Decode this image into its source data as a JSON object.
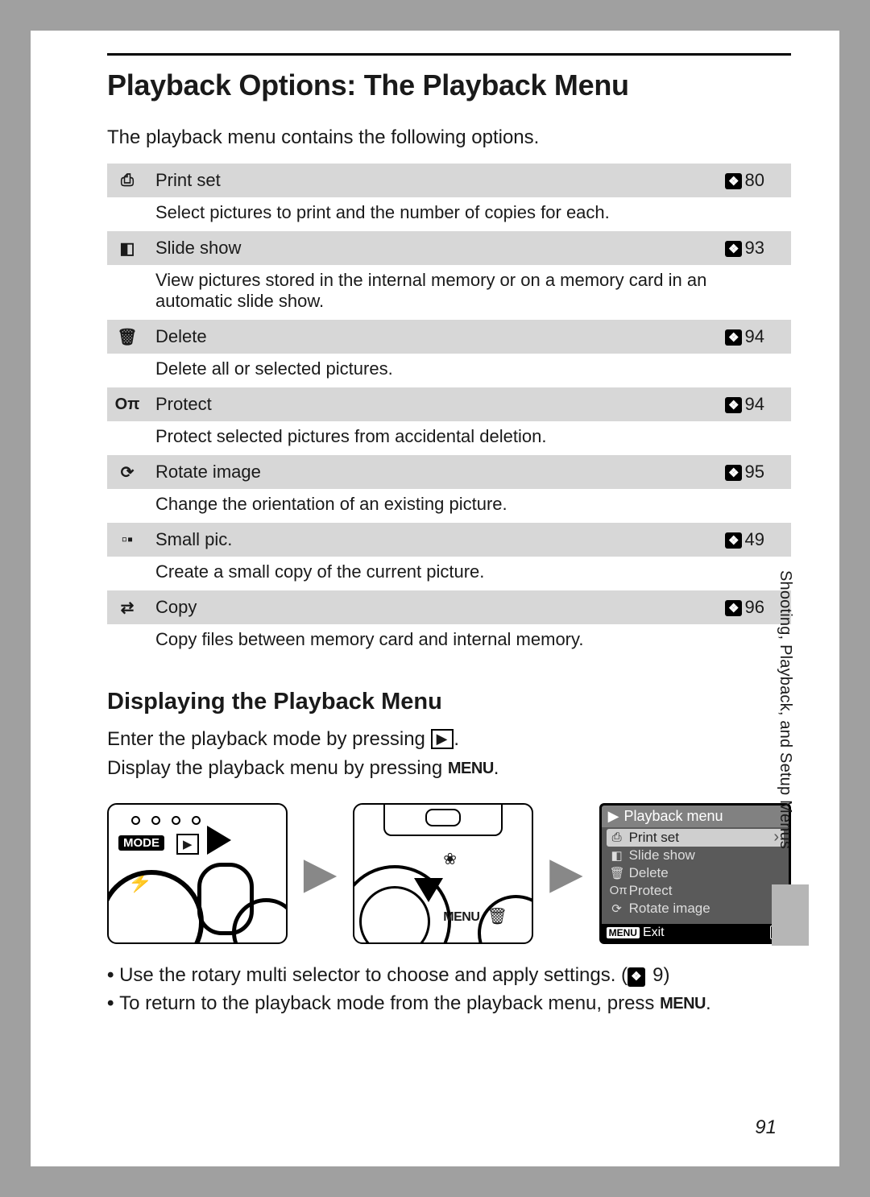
{
  "heading": "Playback Options: The Playback Menu",
  "intro": "The playback menu contains the following options.",
  "ref_badge": "❖",
  "options": [
    {
      "icon": "⎙",
      "title": "Print set",
      "page": "80",
      "desc": "Select pictures to print and the number of copies for each."
    },
    {
      "icon": "◧",
      "title": "Slide show",
      "page": "93",
      "desc": "View pictures stored in the internal memory or on a memory card in an automatic slide show."
    },
    {
      "icon": "🗑",
      "title": "Delete",
      "page": "94",
      "desc": "Delete all or selected pictures."
    },
    {
      "icon": "Oπ",
      "title": "Protect",
      "page": "94",
      "desc": "Protect selected pictures from accidental deletion."
    },
    {
      "icon": "⟳",
      "title": "Rotate image",
      "page": "95",
      "desc": "Change the orientation of an existing picture."
    },
    {
      "icon": "▫▪",
      "title": "Small pic.",
      "page": "49",
      "desc": "Create a small copy of the current picture."
    },
    {
      "icon": "⇄",
      "title": "Copy",
      "page": "96",
      "desc": "Copy files between memory card and internal memory."
    }
  ],
  "subheading": "Displaying the Playback Menu",
  "enter_text_pre": "Enter the playback mode by pressing ",
  "enter_icon": "▶",
  "enter_text_post": ".",
  "display_text_pre": "Display the playback menu by pressing ",
  "menu_word": "MENU",
  "display_text_post": ".",
  "fig1": {
    "mode": "MODE",
    "play": "▶",
    "flash": "⚡"
  },
  "fig2": {
    "menu": "MENU",
    "tulip": "❀",
    "trash": "🗑"
  },
  "screen": {
    "play_icon": "▶",
    "title": "Playback menu",
    "items": [
      {
        "icon": "⎙",
        "label": "Print set",
        "selected": true
      },
      {
        "icon": "◧",
        "label": "Slide show",
        "selected": false
      },
      {
        "icon": "🗑",
        "label": "Delete",
        "selected": false
      },
      {
        "icon": "Oπ",
        "label": "Protect",
        "selected": false
      },
      {
        "icon": "⟳",
        "label": "Rotate image",
        "selected": false
      }
    ],
    "menu_btn": "MENU",
    "exit": "Exit",
    "help": "?"
  },
  "bullets": [
    {
      "pre": "Use the rotary multi selector to choose and apply settings. (",
      "badge": true,
      "num": "9",
      "post": ")"
    },
    {
      "pre": "To return to the playback mode from the playback menu, press ",
      "menu": true,
      "post": "."
    }
  ],
  "sidetext": "Shooting, Playback, and Setup Menus",
  "page_number": "91"
}
